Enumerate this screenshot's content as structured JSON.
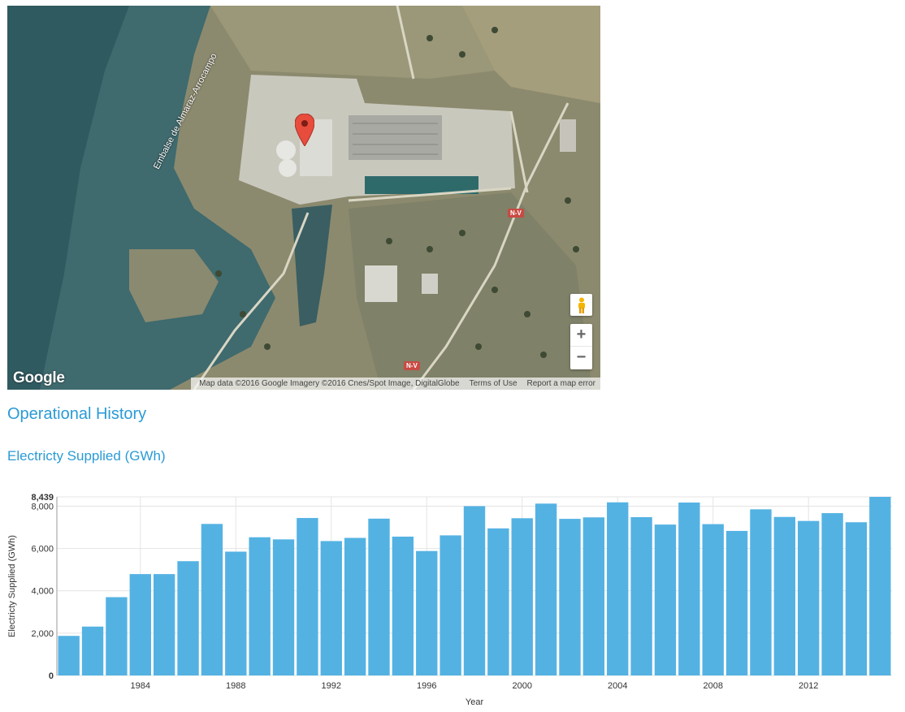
{
  "map": {
    "road_labels": [
      "N-V",
      "N-V"
    ],
    "water_label": "Embalse de Almaraz-Arrocampo",
    "google_logo": "Google",
    "attribution": "Map data ©2016 Google Imagery ©2016 Cnes/Spot Image, DigitalGlobe",
    "terms": "Terms of Use",
    "report": "Report a map error",
    "zoom_in": "+",
    "zoom_out": "−",
    "icons": [
      "pegman-icon",
      "map-pin-icon"
    ]
  },
  "section_title": "Operational History",
  "chart_title": "Electricty Supplied (GWh)",
  "colors": {
    "accent": "#2a9bd5",
    "bar": "#54b2e3"
  },
  "chart_data": {
    "type": "bar",
    "xlabel": "Year",
    "ylabel": "Electricty Supplied (GWh)",
    "ylim": [
      0,
      8439
    ],
    "y_ticks": [
      "0",
      "2,000",
      "4,000",
      "6,000",
      "8,000",
      "8,439"
    ],
    "x_ticks": [
      "1984",
      "1988",
      "1992",
      "1996",
      "2000",
      "2004",
      "2008",
      "2012"
    ],
    "grid": true,
    "categories": [
      1981,
      1982,
      1983,
      1984,
      1985,
      1986,
      1987,
      1988,
      1989,
      1990,
      1991,
      1992,
      1993,
      1994,
      1995,
      1996,
      1997,
      1998,
      1999,
      2000,
      2001,
      2002,
      2003,
      2004,
      2005,
      2006,
      2007,
      2008,
      2009,
      2010,
      2011,
      2012,
      2013,
      2014,
      2015
    ],
    "values": [
      1870,
      2310,
      3700,
      4790,
      4790,
      5400,
      7160,
      5850,
      6530,
      6430,
      7440,
      6350,
      6500,
      7410,
      6560,
      5880,
      6620,
      8000,
      6950,
      7430,
      8120,
      7400,
      7470,
      8180,
      7480,
      7130,
      8170,
      7150,
      6830,
      7850,
      7490,
      7300,
      7670,
      7240,
      8439
    ]
  }
}
